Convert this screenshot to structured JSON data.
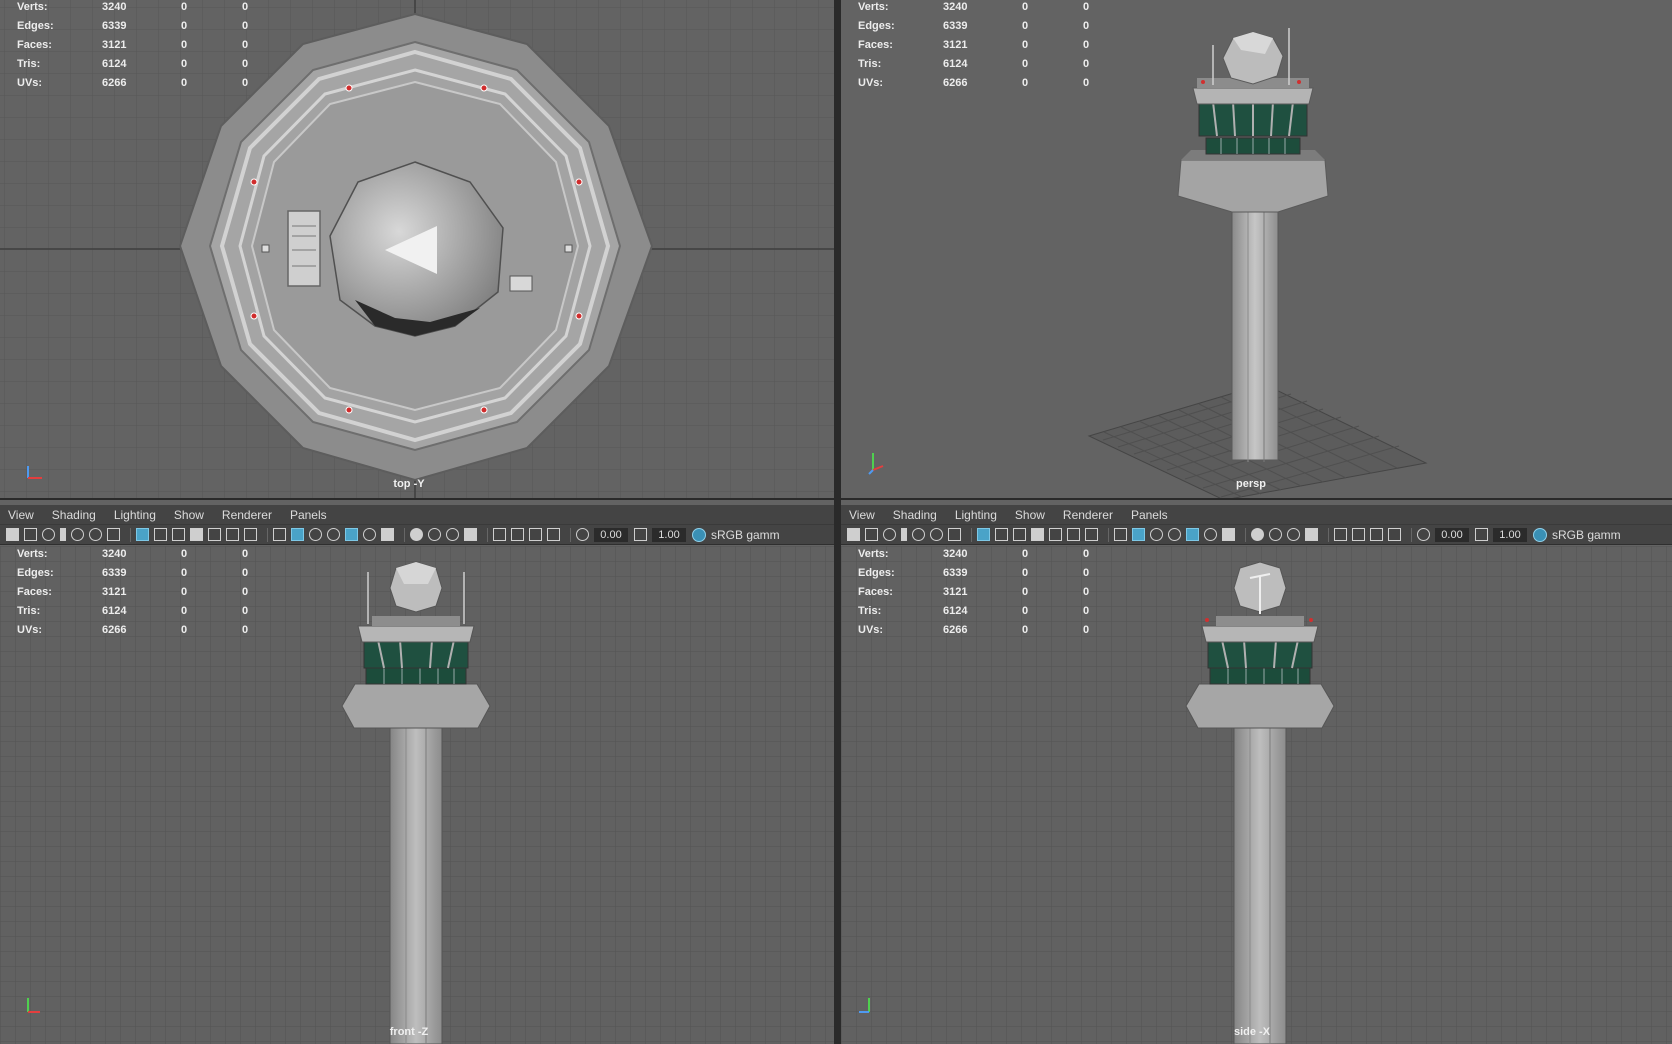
{
  "menus": [
    "View",
    "Shading",
    "Lighting",
    "Show",
    "Renderer",
    "Panels"
  ],
  "hud": {
    "rows": [
      {
        "label": "Verts:",
        "value": "3240",
        "a": "0",
        "b": "0"
      },
      {
        "label": "Edges:",
        "value": "6339",
        "a": "0",
        "b": "0"
      },
      {
        "label": "Faces:",
        "value": "3121",
        "a": "0",
        "b": "0"
      },
      {
        "label": "Tris:",
        "value": "6124",
        "a": "0",
        "b": "0"
      },
      {
        "label": "UVs:",
        "value": "6266",
        "a": "0",
        "b": "0"
      }
    ]
  },
  "toolbar": {
    "exposure": "0.00",
    "gamma": "1.00",
    "colorspace": "sRGB gamm"
  },
  "viewports": {
    "top": {
      "label": "top -Y"
    },
    "persp": {
      "label": "persp"
    },
    "front": {
      "label": "front -Z"
    },
    "side": {
      "label": "side -X"
    }
  },
  "colors": {
    "viewport_bg": "#636363",
    "grid": "#555555",
    "ui_bg": "#444444",
    "accent": "#4aa3c8",
    "glass": "#1e4a3c",
    "concrete": "#a9a9a9"
  }
}
